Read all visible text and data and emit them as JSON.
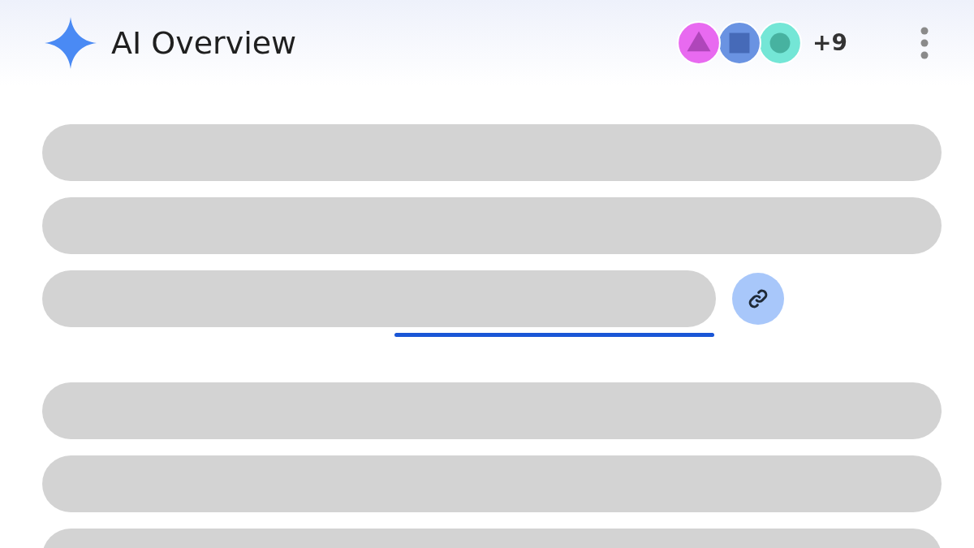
{
  "header": {
    "title": "AI Overview",
    "sources": [
      {
        "kind": "triangle",
        "color": "#e86af0"
      },
      {
        "kind": "square",
        "color": "#6a93e2"
      },
      {
        "kind": "circle",
        "color": "#74e6d6"
      }
    ],
    "more_sources": "+9"
  },
  "paragraphs": [
    [
      {
        "kind": "full"
      },
      {
        "kind": "full"
      },
      {
        "kind": "cited"
      }
    ],
    [
      {
        "kind": "full"
      },
      {
        "kind": "full"
      },
      {
        "kind": "full"
      }
    ]
  ]
}
